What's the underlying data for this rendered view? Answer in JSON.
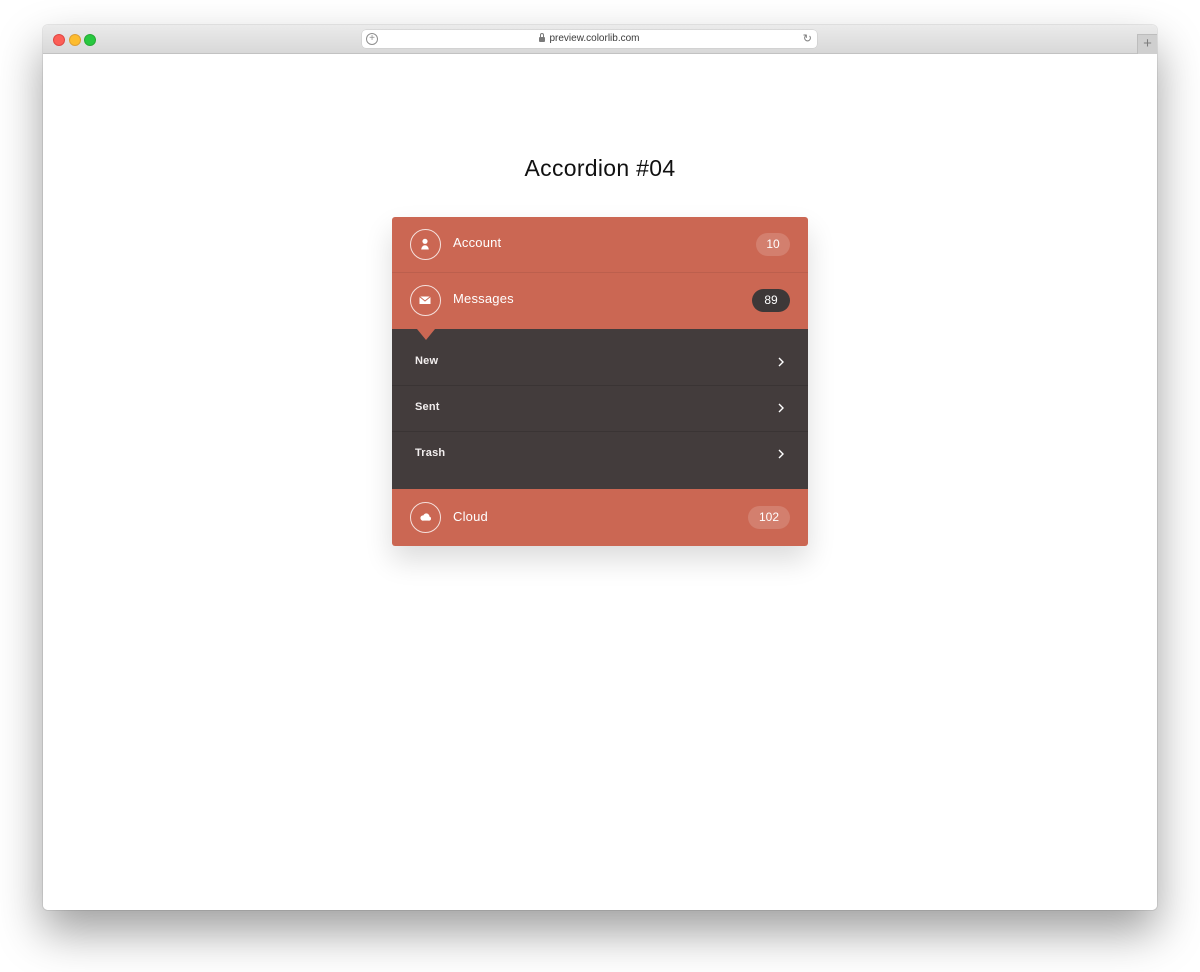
{
  "browser": {
    "url": "preview.colorlib.com",
    "new_tab_label": "+",
    "icons": [
      "add-icon",
      "lock-icon",
      "reload-icon"
    ]
  },
  "page": {
    "title": "Accordion #04"
  },
  "accordion": {
    "items": [
      {
        "label": "Account",
        "count": "10",
        "icon": "user-icon",
        "badge_style": "light"
      },
      {
        "label": "Messages",
        "count": "89",
        "icon": "envelope-icon",
        "badge_style": "dark",
        "expanded": true
      },
      {
        "label": "Cloud",
        "count": "102",
        "icon": "cloud-icon",
        "badge_style": "light"
      }
    ],
    "submenu": [
      {
        "label": "New",
        "icon": "chevron-right-icon"
      },
      {
        "label": "Sent",
        "icon": "chevron-right-icon"
      },
      {
        "label": "Trash",
        "icon": "chevron-right-icon"
      }
    ]
  },
  "colors": {
    "accent": "#cb6753",
    "submenu_bg": "#433c3c",
    "badge_dark": "#3d3838",
    "text_light": "#ffffff"
  }
}
